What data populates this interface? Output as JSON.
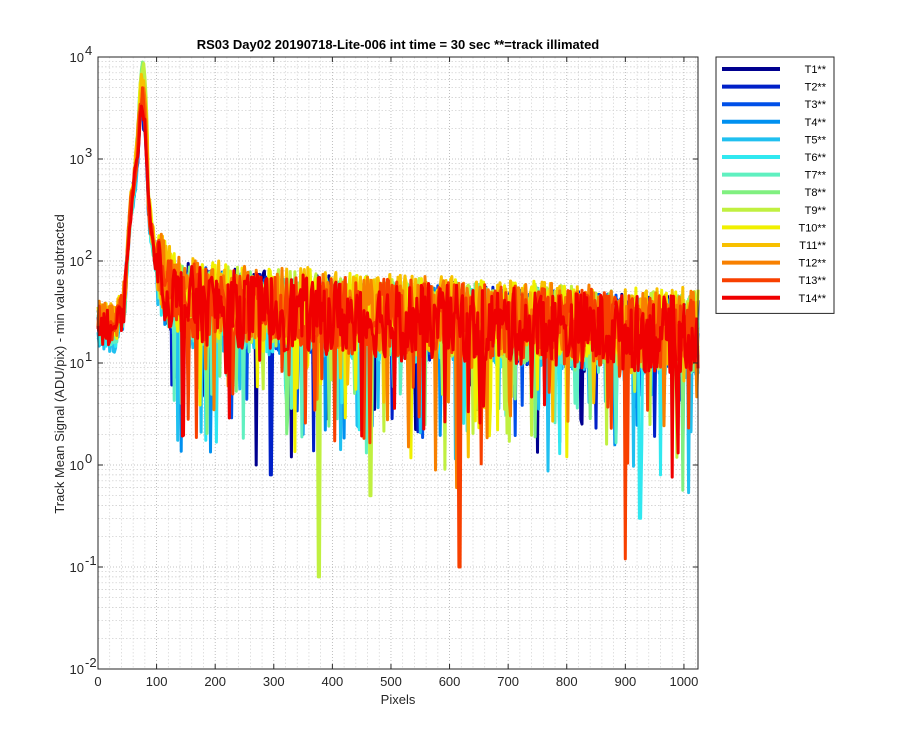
{
  "chart_data": {
    "type": "line",
    "title": "RS03 Day02 20190718-Lite-006 int time = 30 sec   **=track illimated",
    "xlabel": "Pixels",
    "ylabel": "Track Mean Signal (ADU/pix) - min value subtracted",
    "xlim": [
      0,
      1024
    ],
    "ylim": [
      0.01,
      10000
    ],
    "yscale": "log",
    "grid": "on (major and minor)",
    "legend_position": "outside-right",
    "x_ticks": [
      "0",
      "100",
      "200",
      "300",
      "400",
      "500",
      "600",
      "700",
      "800",
      "900",
      "1000"
    ],
    "y_tick_mantissa": [
      "10",
      "10",
      "10",
      "10",
      "10",
      "10",
      "10"
    ],
    "y_tick_exponents": [
      "-2",
      "-1",
      "0",
      "1",
      "2",
      "3",
      "4"
    ],
    "profile": {
      "x": [
        0,
        30,
        45,
        55,
        62,
        68,
        72,
        76,
        80,
        85,
        92,
        100,
        115,
        130,
        150,
        180,
        220,
        260,
        300,
        350,
        400,
        450,
        500,
        550,
        600,
        650,
        700,
        750,
        800,
        850,
        900,
        950,
        1000,
        1024
      ],
      "y": [
        25,
        22,
        40,
        300,
        600,
        900,
        1800,
        4000,
        1200,
        400,
        180,
        100,
        60,
        45,
        40,
        38,
        36,
        35,
        33,
        32,
        30,
        29,
        28,
        27,
        26,
        25,
        24,
        24,
        23,
        22,
        21,
        20,
        20,
        20
      ]
    },
    "dips": [
      {
        "x": 270,
        "y": 1.0,
        "series": "T1**"
      },
      {
        "x": 295,
        "y": 0.8,
        "series": "T2**"
      },
      {
        "x": 330,
        "y": 1.2,
        "series": "T1**"
      },
      {
        "x": 377,
        "y": 0.08,
        "series": "T9**"
      },
      {
        "x": 465,
        "y": 0.5,
        "series": "T9**"
      },
      {
        "x": 617,
        "y": 0.1,
        "series": "T13**"
      },
      {
        "x": 612,
        "y": 0.6,
        "series": "T12**"
      },
      {
        "x": 632,
        "y": 1.2,
        "series": "T11**"
      },
      {
        "x": 900,
        "y": 0.12,
        "series": "T13**"
      },
      {
        "x": 925,
        "y": 0.3,
        "series": "T6**"
      },
      {
        "x": 960,
        "y": 0.8,
        "series": "T6**"
      }
    ],
    "series": [
      {
        "name": "T1**",
        "color": "#00008f",
        "peak": 2300,
        "base": 1.0
      },
      {
        "name": "T2**",
        "color": "#0020c8",
        "peak": 2600,
        "base": 0.95
      },
      {
        "name": "T3**",
        "color": "#0050e8",
        "peak": 2800,
        "base": 0.95
      },
      {
        "name": "T4**",
        "color": "#0090f0",
        "peak": 3000,
        "base": 0.9
      },
      {
        "name": "T5**",
        "color": "#20c0f0",
        "peak": 3500,
        "base": 0.85
      },
      {
        "name": "T6**",
        "color": "#30e8f0",
        "peak": 4500,
        "base": 0.9
      },
      {
        "name": "T7**",
        "color": "#60f0c0",
        "peak": 6000,
        "base": 0.95
      },
      {
        "name": "T8**",
        "color": "#80f080",
        "peak": 8500,
        "base": 1.0
      },
      {
        "name": "T9**",
        "color": "#c0f040",
        "peak": 7500,
        "base": 1.05
      },
      {
        "name": "T10**",
        "color": "#f0f000",
        "peak": 6500,
        "base": 1.1
      },
      {
        "name": "T11**",
        "color": "#f8c000",
        "peak": 5500,
        "base": 1.15
      },
      {
        "name": "T12**",
        "color": "#f88000",
        "peak": 4000,
        "base": 1.1
      },
      {
        "name": "T13**",
        "color": "#f84000",
        "peak": 3200,
        "base": 1.0
      },
      {
        "name": "T14**",
        "color": "#f00000",
        "peak": 3000,
        "base": 0.95
      }
    ]
  }
}
